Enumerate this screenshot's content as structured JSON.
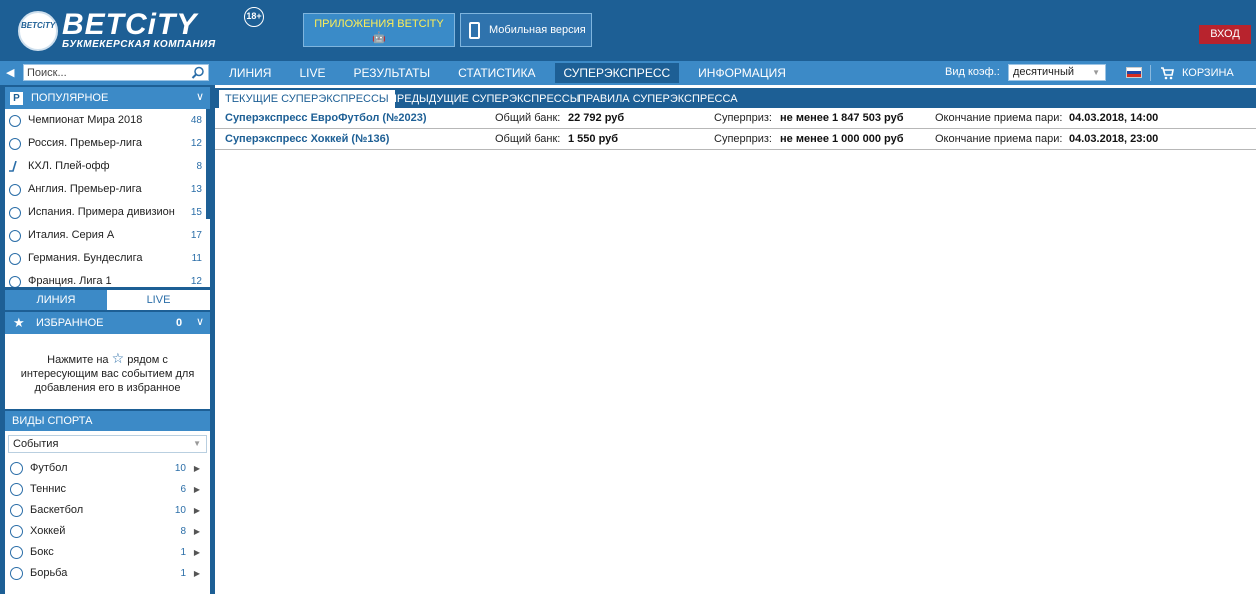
{
  "header": {
    "brand": "BETCiTY",
    "tagline": "БУКМЕКЕРСКАЯ КОМПАНИЯ",
    "ball_text": "BETCiTY",
    "age": "18+",
    "apps_button": "ПРИЛОЖЕНИЯ BETCITY",
    "apps_platforms": "🤖 ",
    "mobile_button": "Мобильная версия",
    "login_button": "ВХОД"
  },
  "nav": {
    "search_placeholder": "Поиск...",
    "tabs": [
      "ЛИНИЯ",
      "LIVE",
      "РЕЗУЛЬТАТЫ",
      "СТАТИСТИКА",
      "СУПЕРЭКСПРЕСС",
      "ИНФОРМАЦИЯ"
    ],
    "active_tab": "СУПЕРЭКСПРЕСС",
    "odds_label": "Вид коэф.:",
    "odds_value": "десятичный",
    "cart": "КОРЗИНА"
  },
  "sidebar": {
    "popular_title": "ПОПУЛЯРНОЕ",
    "popular_items": [
      {
        "name": "Чемпионат Мира 2018",
        "count": "48",
        "icon": "soccer-ball-icon"
      },
      {
        "name": "Россия. Премьер-лига",
        "count": "12",
        "icon": "soccer-ball-icon"
      },
      {
        "name": "КХЛ. Плей-офф",
        "count": "8",
        "icon": "hockey-stick-icon"
      },
      {
        "name": "Англия. Премьер-лига",
        "count": "13",
        "icon": "soccer-ball-icon"
      },
      {
        "name": "Испания. Примера дивизион",
        "count": "15",
        "icon": "soccer-ball-icon"
      },
      {
        "name": "Италия. Серия А",
        "count": "17",
        "icon": "soccer-ball-icon"
      },
      {
        "name": "Германия. Бундеслига",
        "count": "11",
        "icon": "soccer-ball-icon"
      },
      {
        "name": "Франция. Лига 1",
        "count": "12",
        "icon": "soccer-ball-icon"
      }
    ],
    "tab_line": "ЛИНИЯ",
    "tab_live": "LIVE",
    "favorites_title": "ИЗБРАННОЕ",
    "favorites_count": "0",
    "favorites_hint_1": "Нажмите на",
    "favorites_hint_2": "рядом с интересующим вас событием для добавления его в избранное",
    "sports_title": "ВИДЫ СПОРТА",
    "events_select": "События",
    "sports": [
      {
        "name": "Футбол",
        "count": "10"
      },
      {
        "name": "Теннис",
        "count": "6"
      },
      {
        "name": "Баскетбол",
        "count": "10"
      },
      {
        "name": "Хоккей",
        "count": "8"
      },
      {
        "name": "Бокс",
        "count": "1"
      },
      {
        "name": "Борьба",
        "count": "1"
      }
    ]
  },
  "main": {
    "subtabs": [
      "ТЕКУЩИЕ СУПЕРЭКСПРЕССЫ",
      "ПРЕДЫДУЩИЕ СУПЕРЭКСПРЕССЫ",
      "ПРАВИЛА СУПЕРЭКСПРЕССА"
    ],
    "active_subtab": "ТЕКУЩИЕ СУПЕРЭКСПРЕССЫ",
    "rows": [
      {
        "title": "Суперэкспресс ЕвроФутбол (№2023)",
        "bank_label": "Общий банк:",
        "bank_value": "22 792 руб",
        "prize_label": "Суперприз:",
        "prize_value": "не менее 1 847 503 руб",
        "end_label": "Окончание приема пари:",
        "end_value": "04.03.2018, 14:00"
      },
      {
        "title": "Суперэкспресс Хоккей (№136)",
        "bank_label": "Общий банк:",
        "bank_value": "1 550 руб",
        "prize_label": "Суперприз:",
        "prize_value": "не менее 1 000 000 руб",
        "end_label": "Окончание приема пари:",
        "end_value": "04.03.2018, 23:00"
      }
    ]
  },
  "colors": {
    "header_bg": "#1d5f95",
    "nav_bg": "#3c8ac7",
    "login_red": "#b8232d",
    "link_blue": "#1d5f95"
  }
}
